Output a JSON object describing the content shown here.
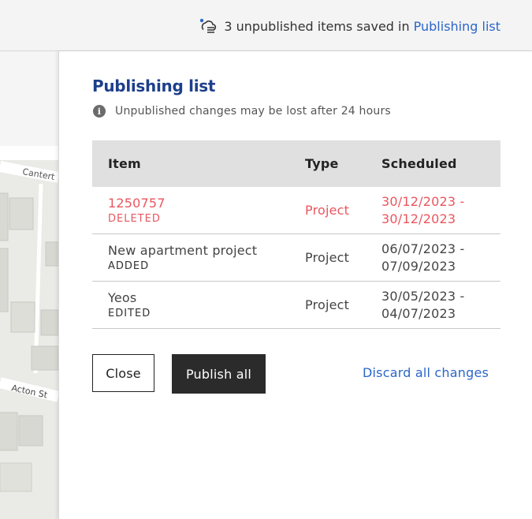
{
  "topbar": {
    "status_text": "3 unpublished items saved in",
    "link_text": "Publishing list",
    "icon": "cloud-list-icon"
  },
  "map": {
    "street_labels": [
      "Cantert",
      "Acton St"
    ]
  },
  "drawer": {
    "title": "Publishing list",
    "notice": "Unpublished changes may be lost after 24 hours",
    "notice_icon": "info-icon",
    "table": {
      "headers": [
        "Item",
        "Type",
        "Scheduled"
      ],
      "rows": [
        {
          "name": "1250757",
          "status": "DELETED",
          "type": "Project",
          "scheduled_start": "30/12/2023 -",
          "scheduled_end": "30/12/2023"
        },
        {
          "name": "New apartment project",
          "status": "ADDED",
          "type": "Project",
          "scheduled_start": "06/07/2023 -",
          "scheduled_end": "07/09/2023"
        },
        {
          "name": "Yeos",
          "status": "EDITED",
          "type": "Project",
          "scheduled_start": "30/05/2023 -",
          "scheduled_end": "04/07/2023"
        }
      ]
    },
    "buttons": {
      "close": "Close",
      "publish_all": "Publish all",
      "discard_all": "Discard all changes"
    }
  },
  "colors": {
    "title": "#1d3f8c",
    "link": "#2b66c9",
    "deleted": "#e9565e",
    "publish_button_bg": "#2b2b2b",
    "header_bg": "#e0e0e0"
  }
}
